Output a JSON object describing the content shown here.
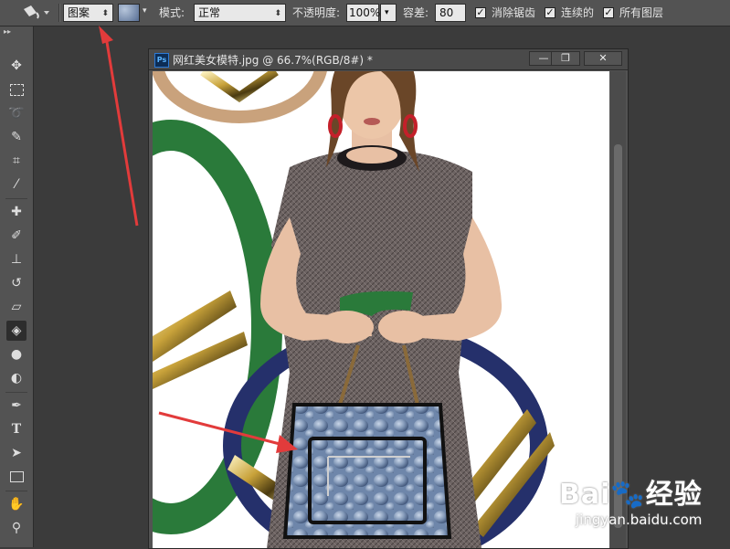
{
  "options_bar": {
    "fill_source": "图案",
    "mode_label": "模式:",
    "mode_value": "正常",
    "opacity_label": "不透明度:",
    "opacity_value": "100%",
    "tolerance_label": "容差:",
    "tolerance_value": "80",
    "anti_alias_label": "消除锯齿",
    "contiguous_label": "连续的",
    "all_layers_label": "所有图层",
    "anti_alias_checked": true,
    "contiguous_checked": true,
    "all_layers_checked": true
  },
  "document": {
    "title": "网红美女模特.jpg @ 66.7%(RGB/8#) *",
    "badge": "Ps",
    "minimize": "—",
    "restore": "❐",
    "close": "✕"
  },
  "watermark": {
    "brand": "Bai",
    "brand2": "经验",
    "url": "jingyan.baidu.com"
  },
  "colors": {
    "green_ring": "#2a7a3a",
    "navy_ring": "#25306b",
    "tan_ring": "#c9a27c",
    "pattern_fill": "#7f95b5",
    "annotation_arrow": "#e23b3b"
  }
}
